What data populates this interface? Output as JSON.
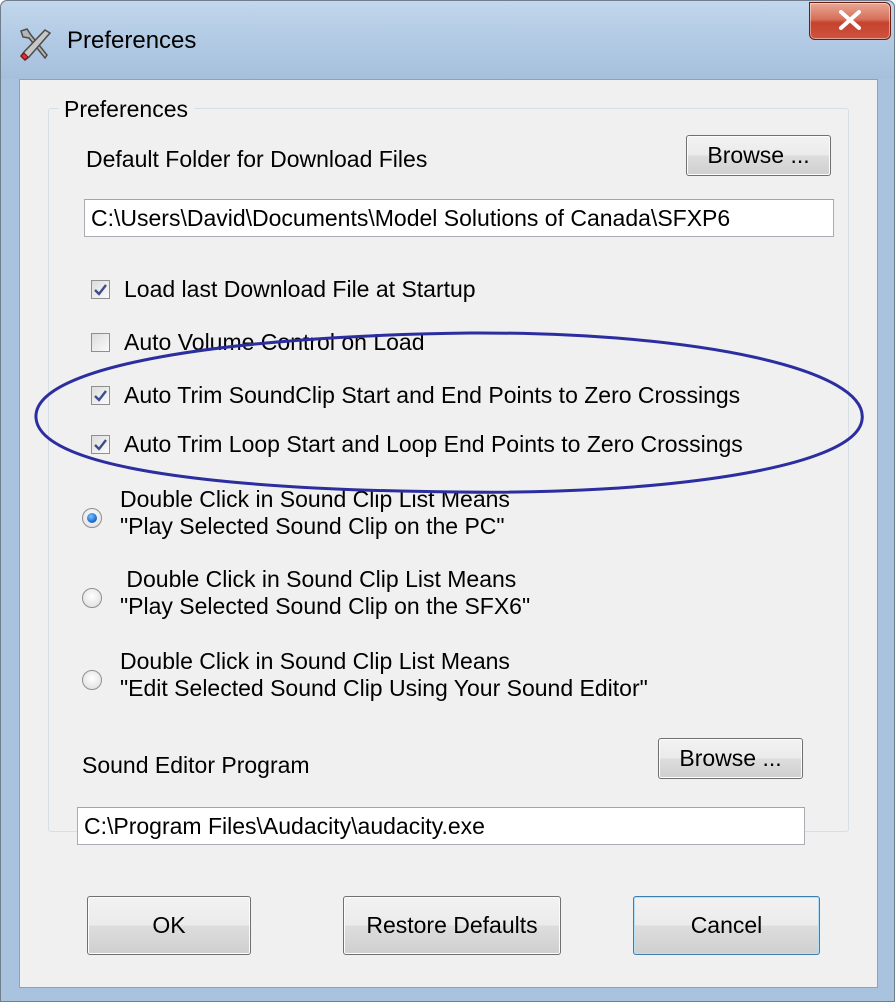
{
  "window": {
    "title": "Preferences",
    "icon": "tools-icon",
    "close_icon": "close-icon"
  },
  "group": {
    "legend": "Preferences"
  },
  "download": {
    "label": "Default Folder for Download Files",
    "browse_label": "Browse ...",
    "path": "C:\\Users\\David\\Documents\\Model Solutions of Canada\\SFXP6"
  },
  "options": {
    "load_last": {
      "label": "Load last Download File at Startup",
      "checked": true
    },
    "auto_volume": {
      "label": "Auto Volume Control on Load",
      "checked": false
    },
    "auto_trim_clip": {
      "label": "Auto Trim SoundClip Start and End Points to Zero Crossings",
      "checked": true
    },
    "auto_trim_loop": {
      "label": "Auto Trim Loop Start and Loop End Points to Zero Crossings",
      "checked": true
    }
  },
  "double_click": {
    "play_pc": {
      "line1": "Double Click in Sound Clip List Means",
      "line2": "\"Play Selected Sound Clip on the PC\"",
      "selected": true
    },
    "play_sfx6": {
      "line1": " Double Click in Sound Clip List Means",
      "line2": "\"Play Selected Sound Clip on the SFX6\"",
      "selected": false
    },
    "edit": {
      "line1": "Double Click in Sound Clip List Means",
      "line2": "\"Edit Selected Sound Clip Using Your Sound Editor\"",
      "selected": false
    }
  },
  "editor": {
    "label": "Sound Editor Program",
    "browse_label": "Browse ...",
    "path": "C:\\Program Files\\Audacity\\audacity.exe"
  },
  "buttons": {
    "ok": "OK",
    "restore": "Restore Defaults",
    "cancel": "Cancel"
  },
  "colors": {
    "annotation": "#2c2ea0",
    "title_bar": "#b3cbe5",
    "close": "#c4432d"
  }
}
